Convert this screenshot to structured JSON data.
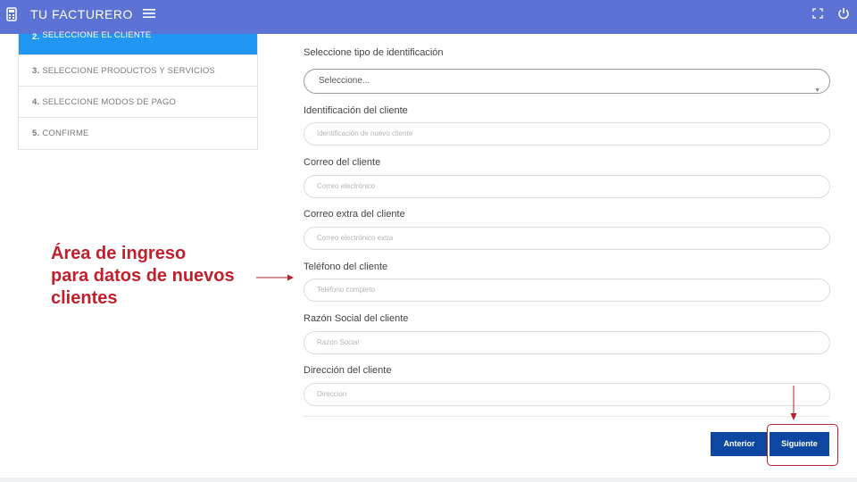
{
  "header": {
    "title": "TU FACTURERO",
    "icons": [
      "logo-icon",
      "menu-icon",
      "fullscreen-icon",
      "power-icon"
    ]
  },
  "steps": [
    {
      "num": "2.",
      "label": "SELECCIONE EL CLIENTE",
      "active": true
    },
    {
      "num": "3.",
      "label": "SELECCIONE PRODUCTOS Y SERVICIOS",
      "active": false
    },
    {
      "num": "4.",
      "label": "SELECCIONE MODOS DE PAGO",
      "active": false
    },
    {
      "num": "5.",
      "label": "CONFIRME",
      "active": false
    }
  ],
  "form": {
    "id_type": {
      "label": "Seleccione tipo de identificación",
      "value": "Seleccione..."
    },
    "identification": {
      "label": "Identificación del cliente",
      "placeholder": "Identificación de nuevo cliente"
    },
    "email": {
      "label": "Correo del cliente",
      "placeholder": "Correo electrónico"
    },
    "email_extra": {
      "label": "Correo extra del cliente",
      "placeholder": "Correo electrónico extra"
    },
    "phone": {
      "label": "Teléfono del cliente",
      "placeholder": "Teléfono completo"
    },
    "business_name": {
      "label": "Razón Social del cliente",
      "placeholder": "Razon Social"
    },
    "address": {
      "label": "Dirección del cliente",
      "placeholder": "Direccion"
    }
  },
  "buttons": {
    "prev": "Anterior",
    "next": "Siguiente"
  },
  "annotation": {
    "lines": [
      "Área de ingreso",
      "para datos de nuevos",
      "clientes"
    ]
  },
  "colors": {
    "topbar": "#5c73d3",
    "active_step": "#2196f3",
    "button": "#0d47a1",
    "annotation": "#c21f2c"
  }
}
